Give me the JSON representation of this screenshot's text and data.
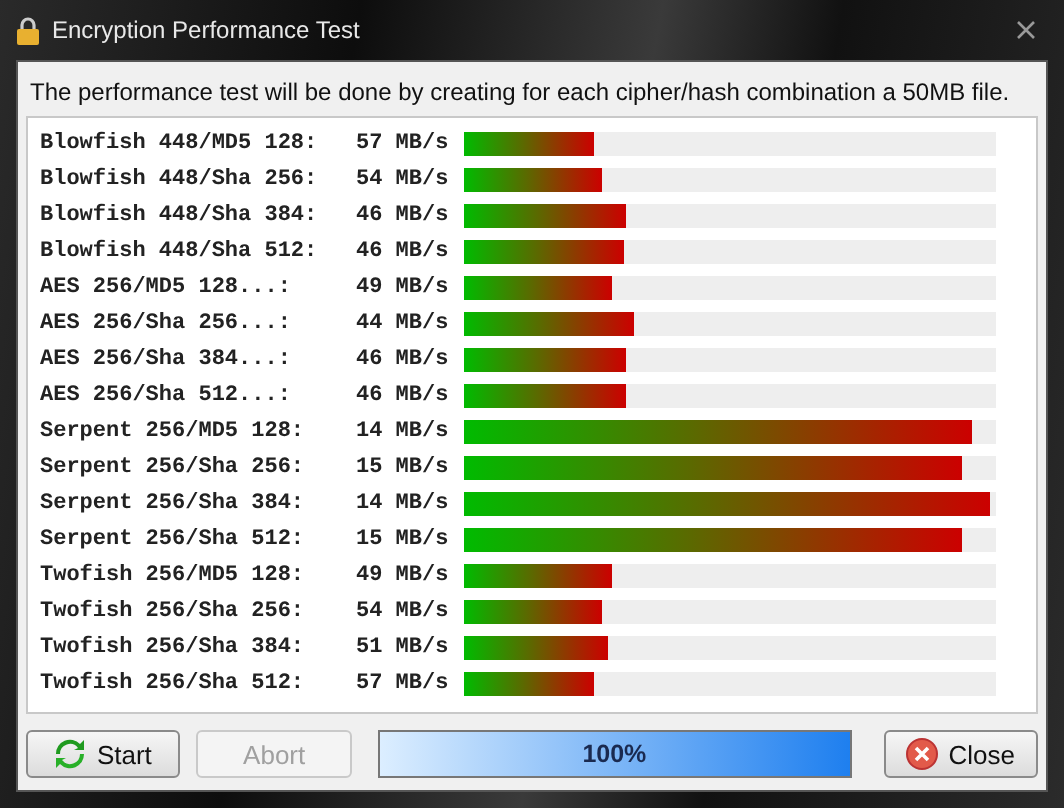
{
  "window": {
    "title": "Encryption Performance Test"
  },
  "description": "The performance test will be done by creating for each cipher/hash combination a 50MB file.",
  "results": [
    {
      "name": "Blowfish 448/MD5 128:",
      "rate": "57 MB/s",
      "level": 0.244
    },
    {
      "name": "Blowfish 448/Sha 256:",
      "rate": "54 MB/s",
      "level": 0.26
    },
    {
      "name": "Blowfish 448/Sha 384:",
      "rate": "46 MB/s",
      "level": 0.305
    },
    {
      "name": "Blowfish 448/Sha 512:",
      "rate": "46 MB/s",
      "level": 0.3
    },
    {
      "name": "AES 256/MD5 128...:",
      "rate": "49 MB/s",
      "level": 0.28
    },
    {
      "name": "AES 256/Sha 256...:",
      "rate": "44 MB/s",
      "level": 0.318
    },
    {
      "name": "AES 256/Sha 384...:",
      "rate": "46 MB/s",
      "level": 0.305
    },
    {
      "name": "AES 256/Sha 512...:",
      "rate": "46 MB/s",
      "level": 0.305
    },
    {
      "name": "Serpent 256/MD5 128:",
      "rate": "14 MB/s",
      "level": 0.955
    },
    {
      "name": "Serpent 256/Sha 256:",
      "rate": "15 MB/s",
      "level": 0.936
    },
    {
      "name": "Serpent 256/Sha 384:",
      "rate": "14 MB/s",
      "level": 0.99
    },
    {
      "name": "Serpent 256/Sha 512:",
      "rate": "15 MB/s",
      "level": 0.936
    },
    {
      "name": "Twofish 256/MD5 128:",
      "rate": "49 MB/s",
      "level": 0.28
    },
    {
      "name": "Twofish 256/Sha 256:",
      "rate": "54 MB/s",
      "level": 0.26
    },
    {
      "name": "Twofish 256/Sha 384:",
      "rate": "51 MB/s",
      "level": 0.27
    },
    {
      "name": "Twofish 256/Sha 512:",
      "rate": "57 MB/s",
      "level": 0.244
    }
  ],
  "buttons": [
    {
      "kind": "start",
      "label": "Start",
      "disabled": false
    },
    {
      "kind": "abort",
      "label": "Abort",
      "disabled": true
    }
  ],
  "progress": {
    "level": 1.0,
    "reading": "100%"
  },
  "close_button": {
    "label": "Close",
    "disabled": false
  }
}
